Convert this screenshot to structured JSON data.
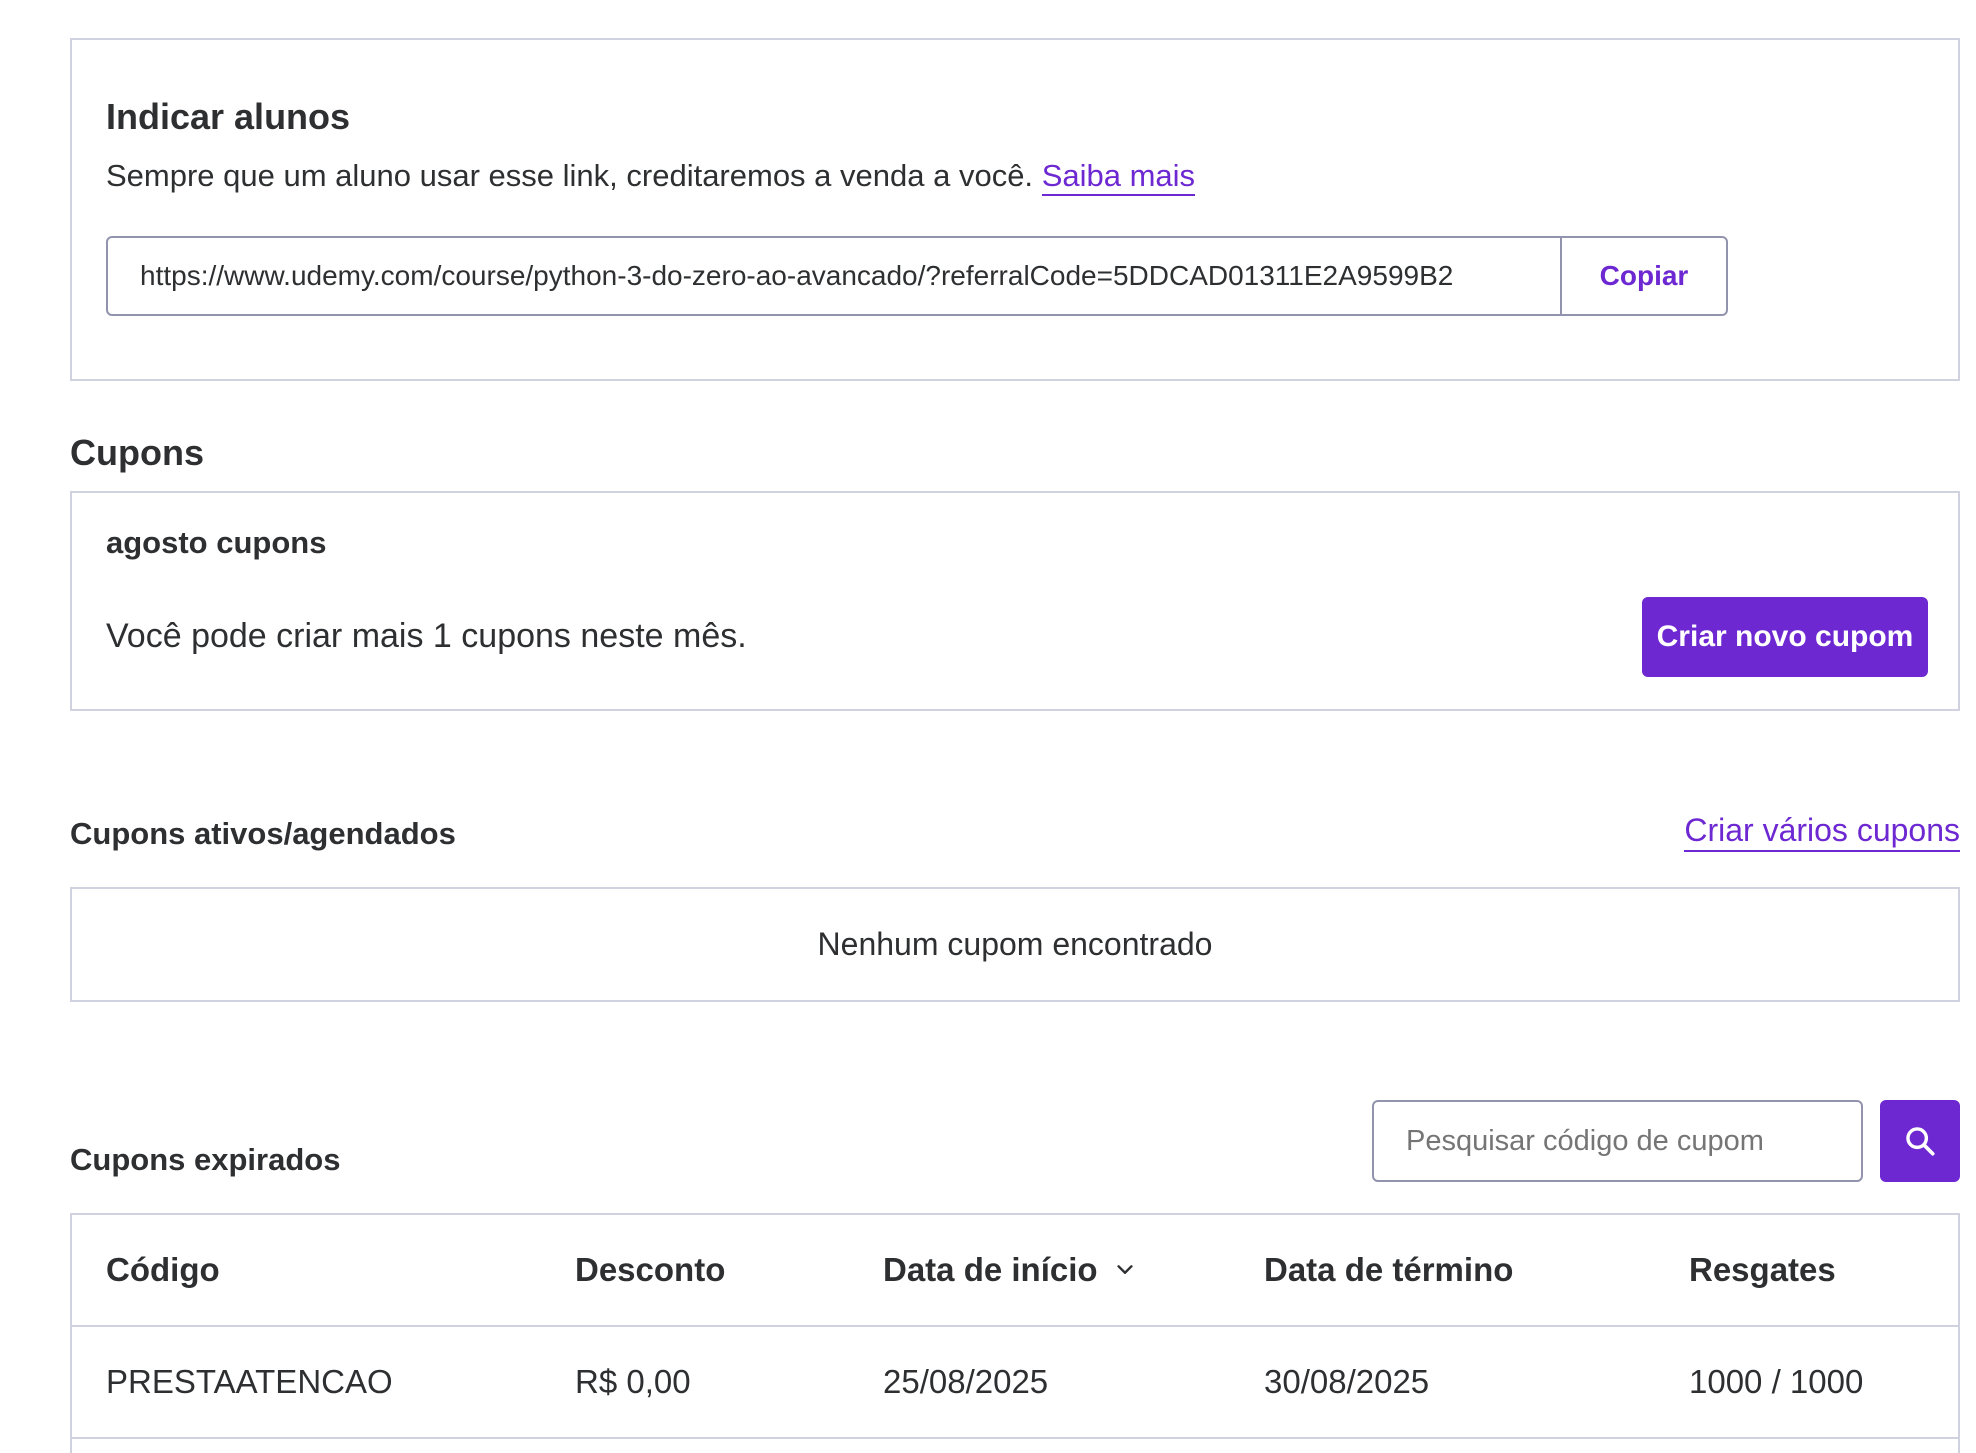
{
  "referral": {
    "title": "Indicar alunos",
    "description": "Sempre que um aluno usar esse link, creditaremos a venda a você.",
    "learn_more": "Saiba mais",
    "url": "https://www.udemy.com/course/python-3-do-zero-ao-avancado/?referralCode=5DDCAD01311E2A9599B2",
    "copy_label": "Copiar"
  },
  "coupons": {
    "title": "Cupons",
    "month_title": "agosto cupons",
    "month_text": "Você pode criar mais 1 cupons neste mês.",
    "create_button": "Criar novo cupom"
  },
  "active": {
    "title": "Cupons ativos/agendados",
    "create_multiple": "Criar vários cupons",
    "empty_text": "Nenhum cupom encontrado"
  },
  "expired": {
    "title": "Cupons expirados",
    "search_placeholder": "Pesquisar código de cupom",
    "columns": [
      "Código",
      "Desconto",
      "Data de início",
      "Data de término",
      "Resgates"
    ],
    "rows": [
      [
        "PRESTAATENCAO",
        "R$ 0,00",
        "25/08/2025",
        "30/08/2025",
        "1000 / 1000"
      ]
    ]
  },
  "colors": {
    "accent": "#6d28d2",
    "border": "#d1d2e0",
    "text": "#2d2f31"
  },
  "icons": {
    "search": "search-icon",
    "sort": "chevron-down-icon"
  }
}
